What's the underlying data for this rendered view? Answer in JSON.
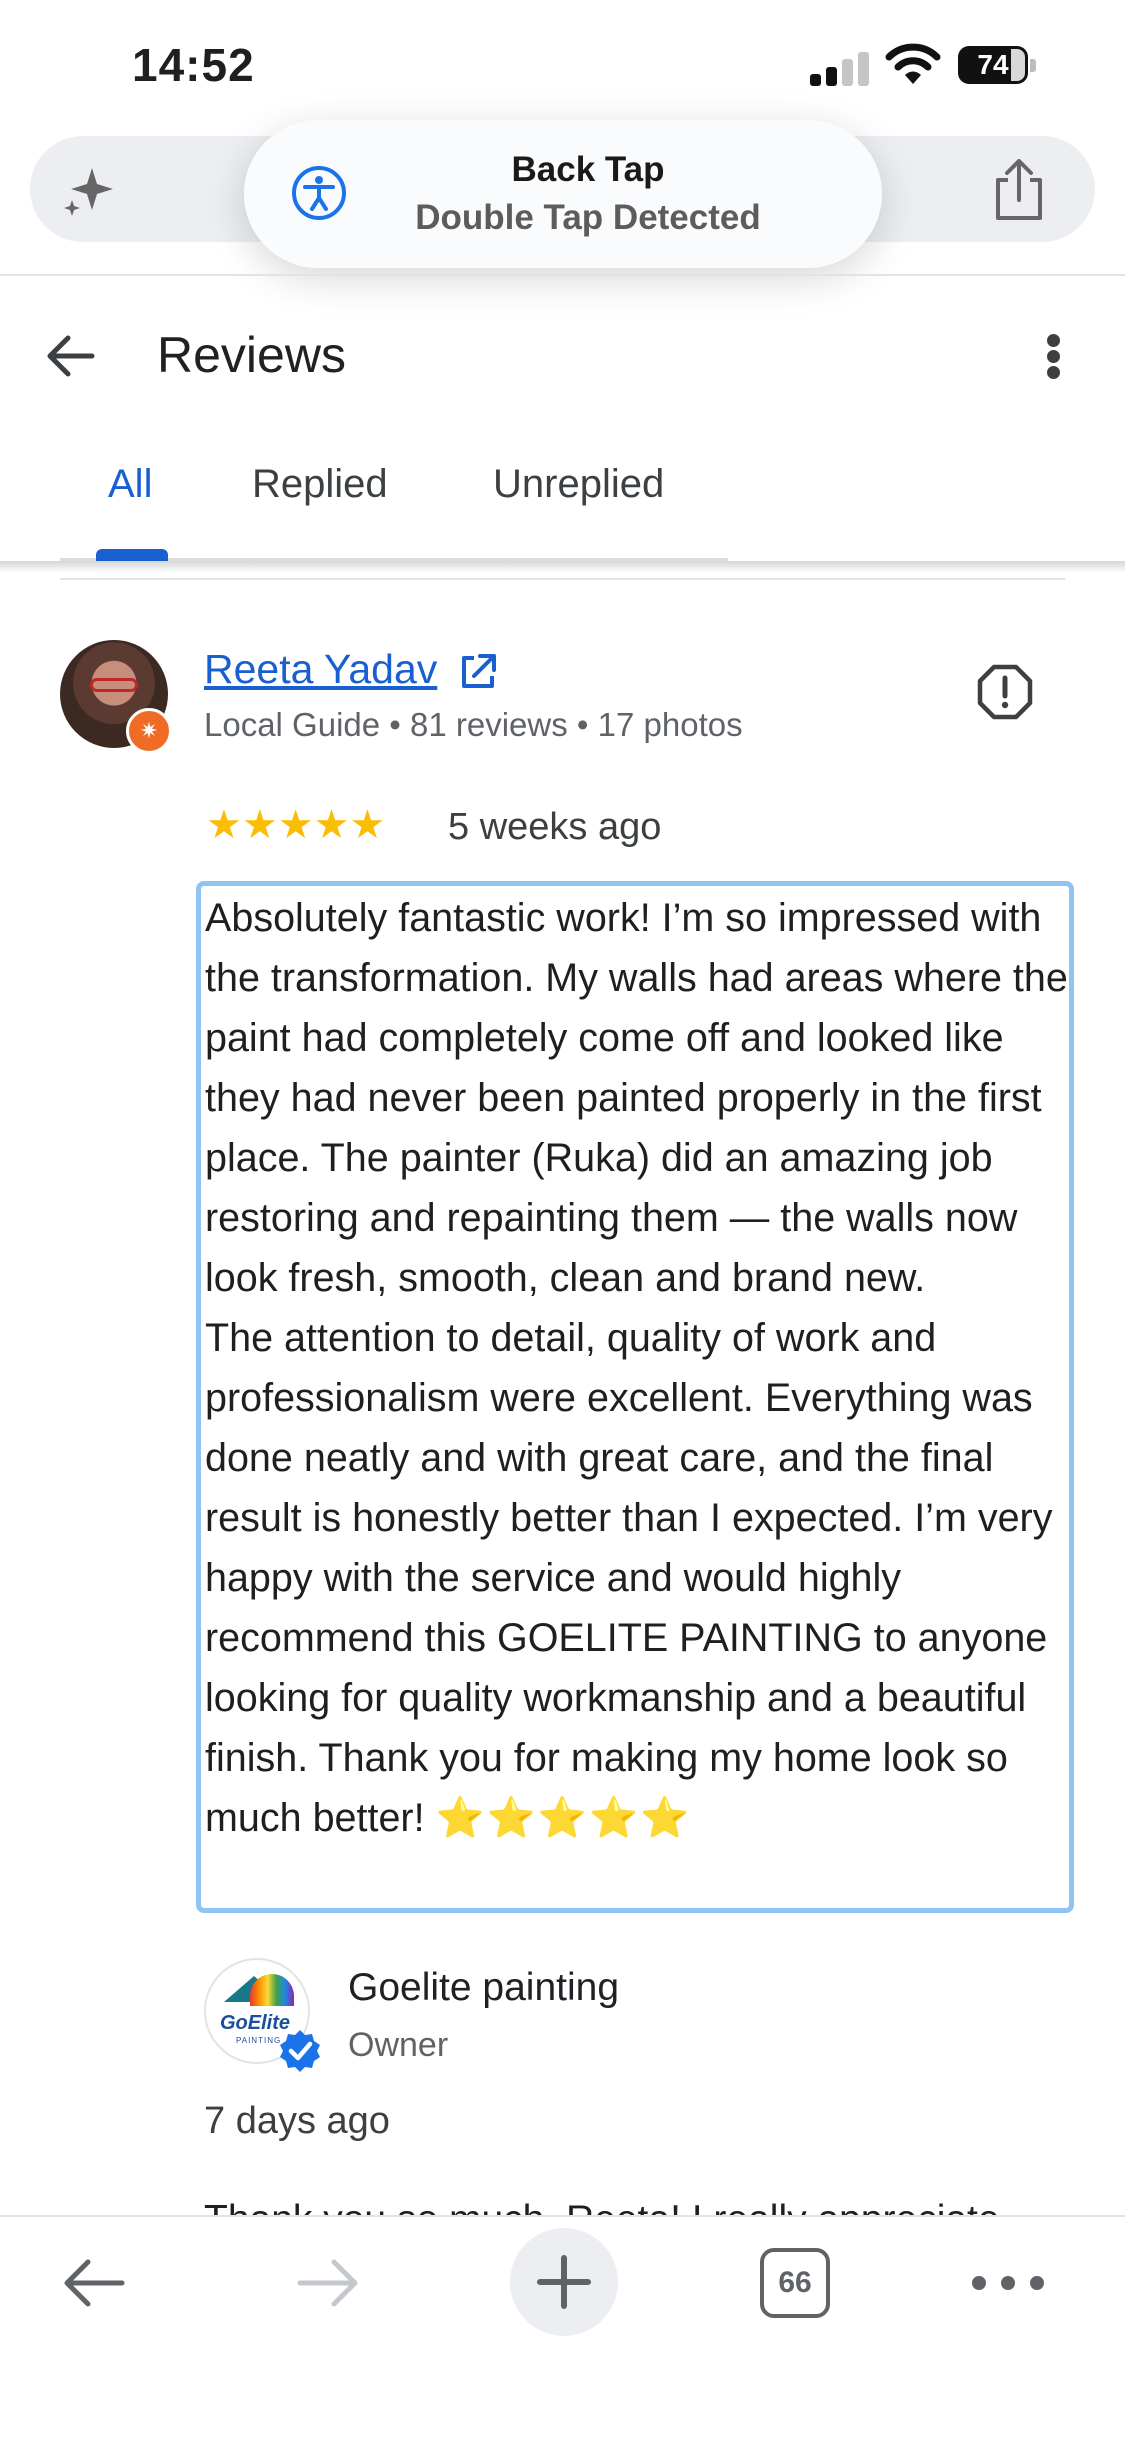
{
  "status_bar": {
    "time": "14:52",
    "battery": "74"
  },
  "browser": {
    "toast": {
      "title": "Back Tap",
      "subtitle": "Double Tap Detected"
    },
    "tab_count": "66"
  },
  "header": {
    "title": "Reviews"
  },
  "tabs": [
    {
      "label": "All",
      "active": true
    },
    {
      "label": "Replied",
      "active": false
    },
    {
      "label": "Unreplied",
      "active": false
    }
  ],
  "review": {
    "reviewer_name": "Reeta Yadav",
    "reviewer_meta": "Local Guide • 81 reviews • 17 photos",
    "rating": 5,
    "stars": "★★★★★",
    "date": "5 weeks ago",
    "text_1": "Absolutely fantastic work! I’m so impressed with the transformation. My walls had areas where the paint had completely come off and looked like they had never been painted properly in the first place. The painter (Ruka) did an amazing job restoring and repainting them — the walls now look fresh, smooth, clean and brand new.",
    "text_2": "The attention to detail, quality of work and professionalism were excellent. Everything was done neatly and with great care, and the final result is honestly better than I expected. I’m very happy with the service and would highly recommend this GOELITE PAINTING to anyone looking for quality workmanship and a beautiful finish. Thank you for making my home look so much better!",
    "emoji_stars": "⭐⭐⭐⭐⭐"
  },
  "owner_reply": {
    "name": "Goelite painting",
    "role": "Owner",
    "logo_text": "GoElite",
    "logo_sub": "PAINTING",
    "date": "7 days ago",
    "text": "Thank you so much, Reeta! I really appreciate"
  },
  "colors": {
    "accent": "#1a5fd0",
    "star": "#fbbc04",
    "highlight_border": "#8fc3f4",
    "guide_badge": "#f06b23"
  }
}
